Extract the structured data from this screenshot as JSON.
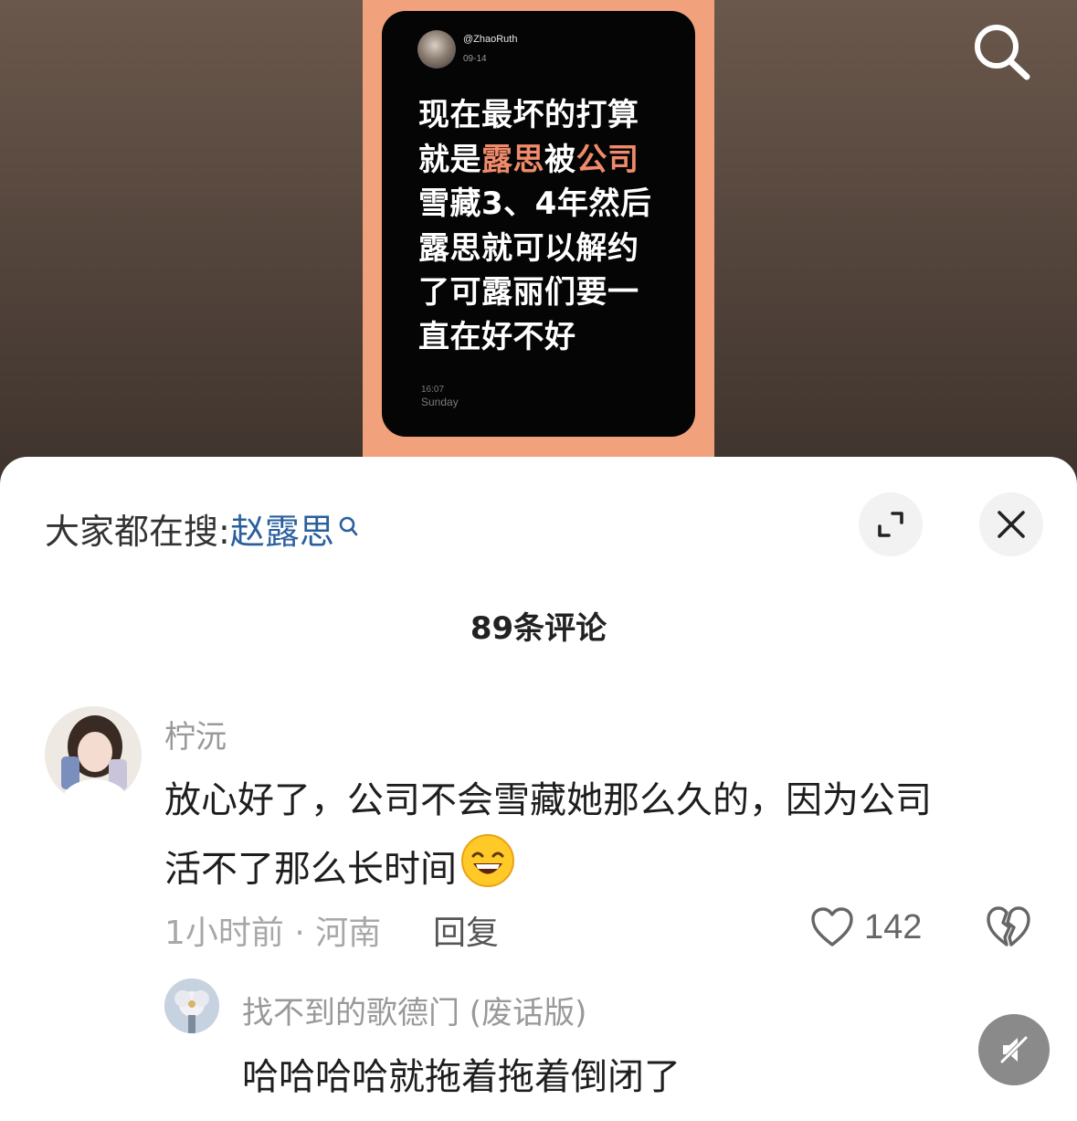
{
  "video": {
    "post": {
      "handle": "@ZhaoRuth",
      "date": "09-14",
      "text_lines": [
        {
          "pre": "现在最坏的打算",
          "hl1": "",
          "mid": "",
          "hl2": ""
        },
        {
          "pre": "就是",
          "hl1": "露思",
          "mid": "被",
          "hl2": "公司"
        },
        {
          "pre": "雪藏3、4年然后",
          "hl1": "",
          "mid": "",
          "hl2": ""
        },
        {
          "pre": "露思就可以解约",
          "hl1": "",
          "mid": "",
          "hl2": ""
        },
        {
          "pre": "了可露丽们要一",
          "hl1": "",
          "mid": "",
          "hl2": ""
        },
        {
          "pre": "直在好不好",
          "hl1": "",
          "mid": "",
          "hl2": ""
        }
      ],
      "time": "16:07",
      "day": "Sunday",
      "highlight_color": "#f08a6a"
    },
    "search_icon": "search-icon"
  },
  "sheet": {
    "hot_search_label": "大家都在搜:",
    "hot_search_keyword": "赵露思",
    "comment_count": "89条评论",
    "comments": [
      {
        "author": "柠沅",
        "text_line1": "放心好了，公司不会雪藏她那么久的，因为公司",
        "text_line2": "活不了那么长时间",
        "emoji": "grinning-face-emoji",
        "time_location": "1小时前 · 河南",
        "reply_label": "回复",
        "likes": "142"
      },
      {
        "author": "找不到的歌德门 (废话版)",
        "text": "哈哈哈哈就拖着拖着倒闭了"
      }
    ],
    "accent_color": "#2a5f9e"
  }
}
